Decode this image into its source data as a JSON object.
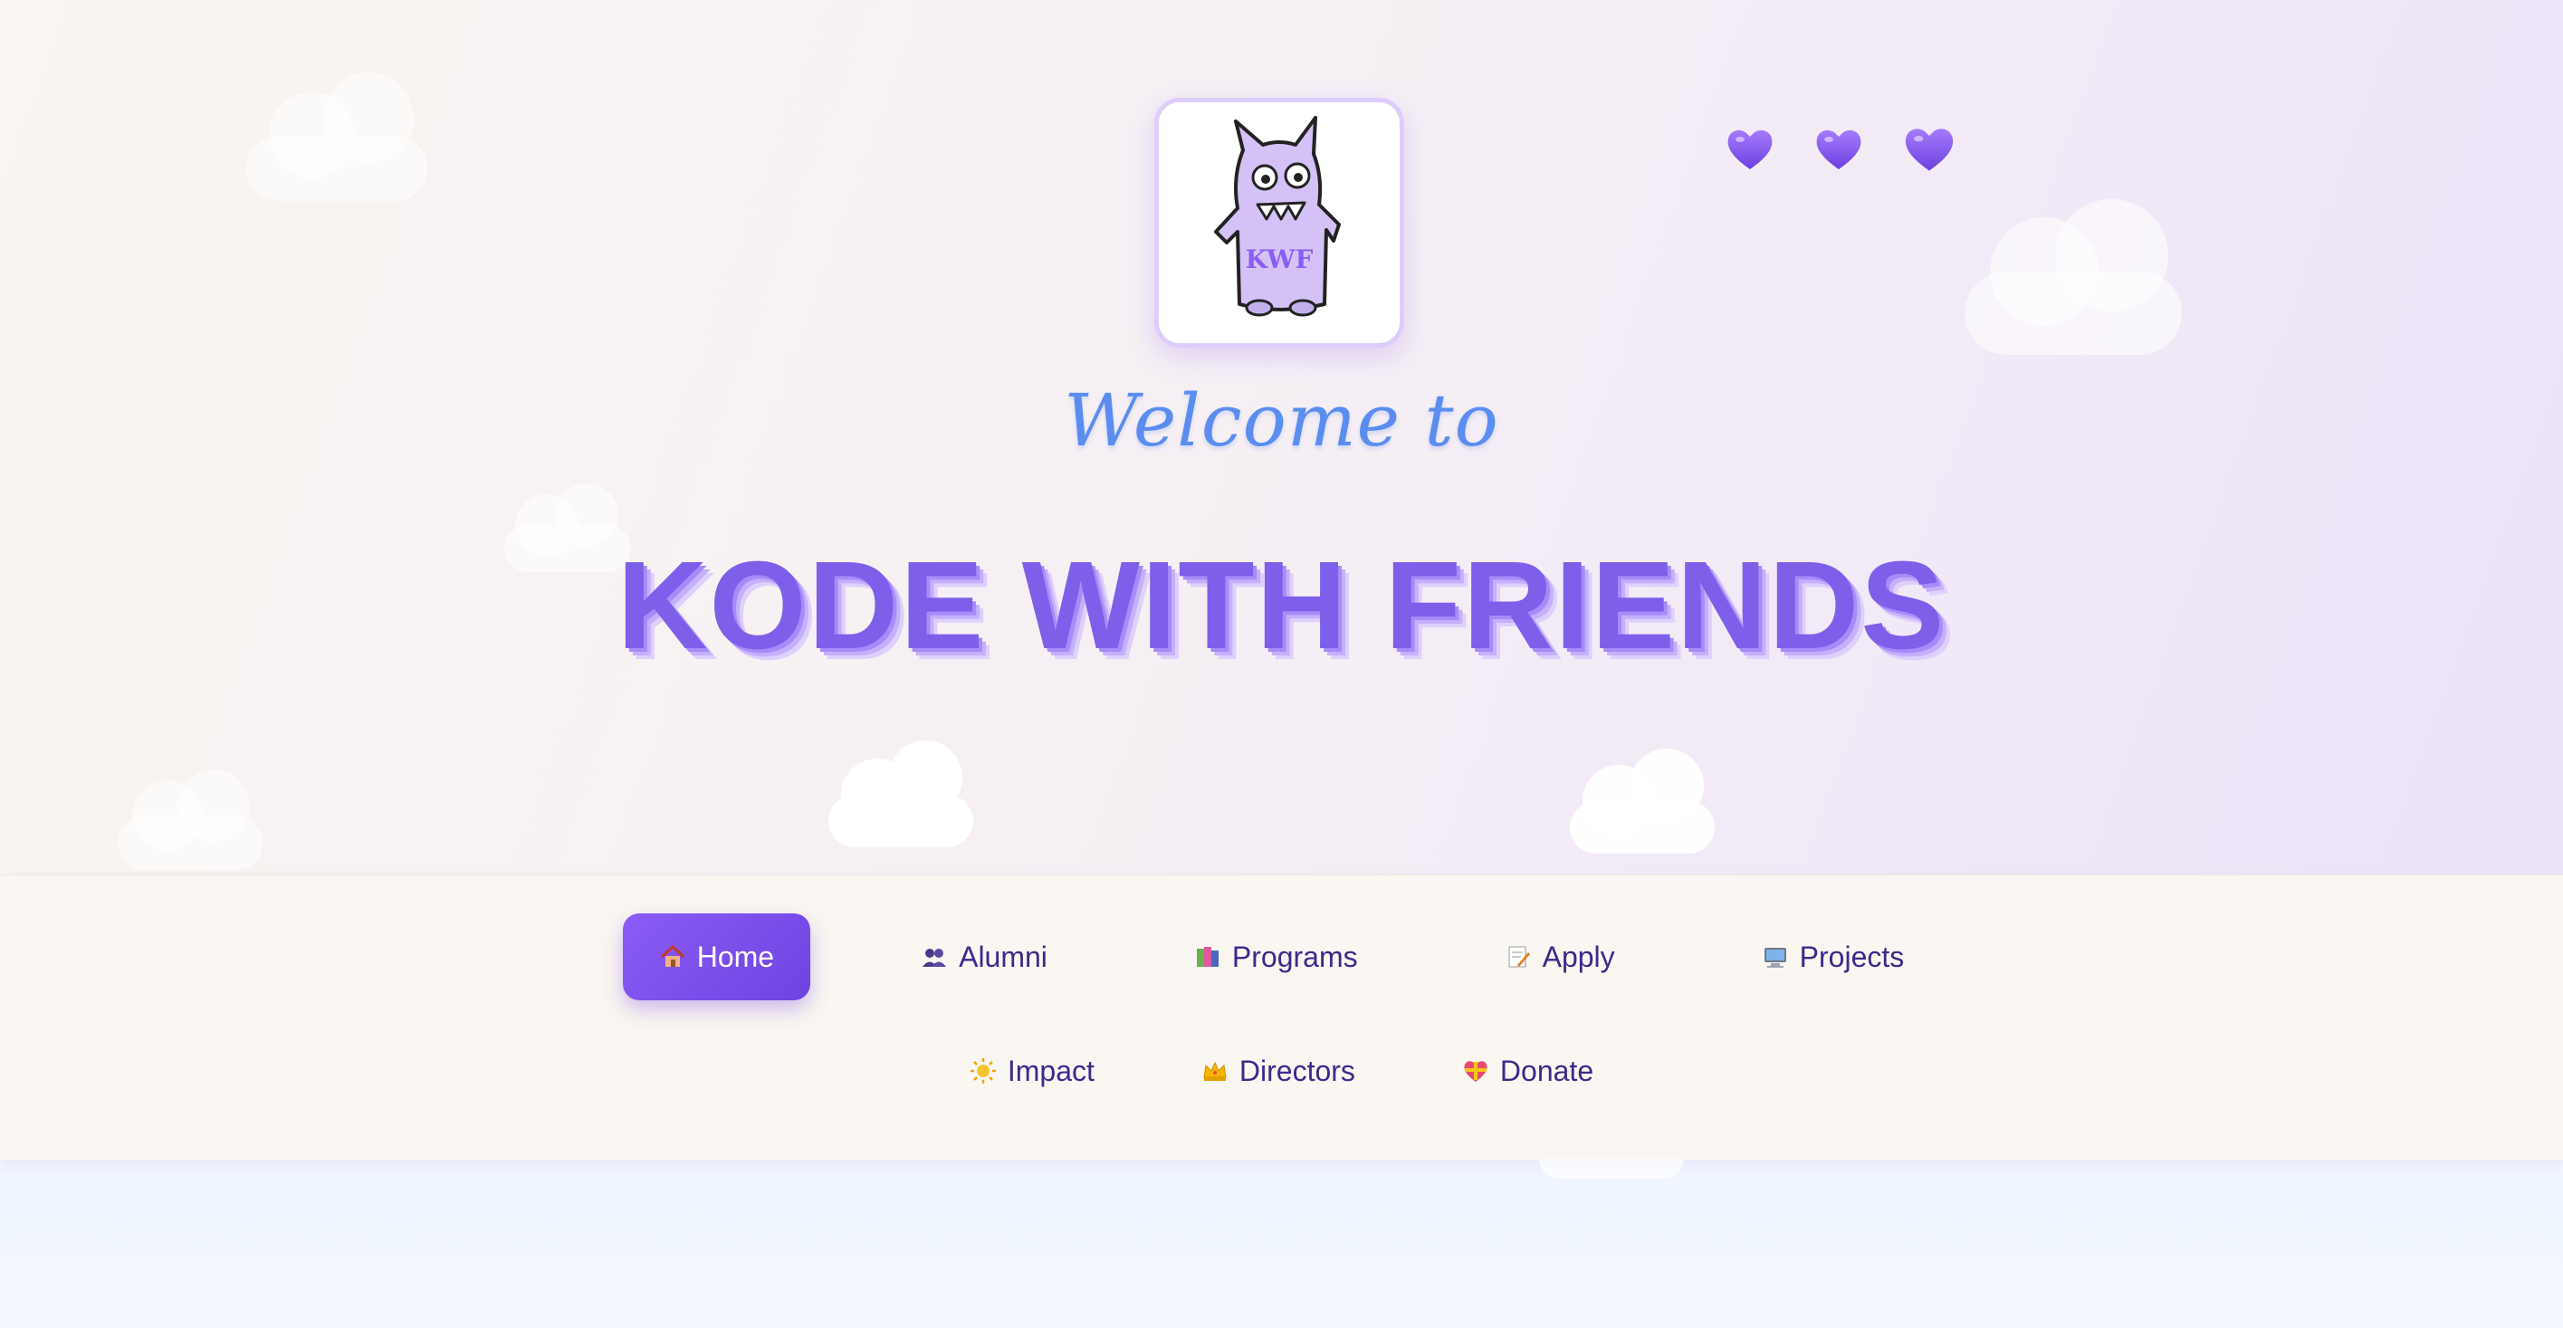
{
  "hero": {
    "logo_alt": "KWF",
    "welcome": "Welcome to",
    "title": "KODE WITH FRIENDS",
    "hearts": [
      "purple-heart",
      "purple-heart",
      "purple-heart"
    ]
  },
  "nav": {
    "items": [
      {
        "label": "Home",
        "icon": "house-icon",
        "active": true
      },
      {
        "label": "Alumni",
        "icon": "people-icon",
        "active": false
      },
      {
        "label": "Programs",
        "icon": "books-icon",
        "active": false
      },
      {
        "label": "Apply",
        "icon": "memo-icon",
        "active": false
      },
      {
        "label": "Projects",
        "icon": "computer-icon",
        "active": false
      },
      {
        "label": "Impact",
        "icon": "sun-icon",
        "active": false
      },
      {
        "label": "Directors",
        "icon": "crown-icon",
        "active": false
      },
      {
        "label": "Donate",
        "icon": "gift-heart-icon",
        "active": false
      }
    ]
  },
  "colors": {
    "accent": "#7d5fe9",
    "welcome": "#5b8def",
    "nav_text": "#3b2a8c",
    "active_bg": "#7c4ee6"
  }
}
